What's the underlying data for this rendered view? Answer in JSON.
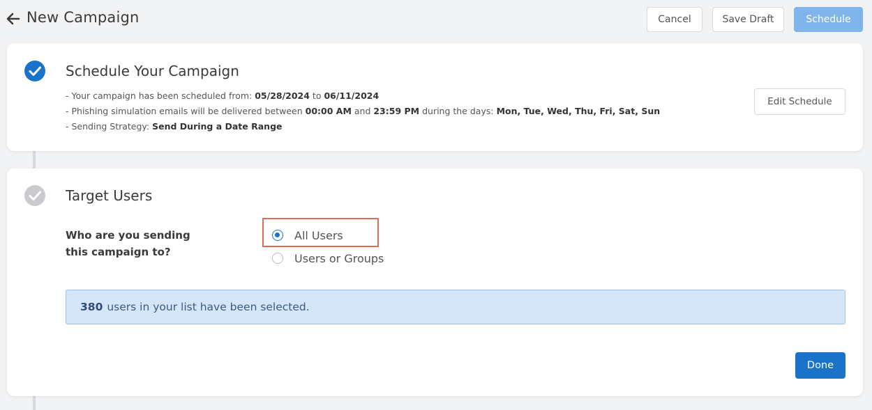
{
  "header": {
    "title": "New Campaign",
    "back_icon": "arrow-left-icon",
    "cancel_label": "Cancel",
    "save_draft_label": "Save Draft",
    "schedule_label": "Schedule"
  },
  "schedule_step": {
    "title": "Schedule Your Campaign",
    "status_icon": "check-circle-icon",
    "line1_prefix": "- Your campaign has been scheduled from: ",
    "start_date": "05/28/2024",
    "line1_to": " to ",
    "end_date": "06/11/2024",
    "line2_prefix": "- Phishing simulation emails will be delivered between ",
    "start_time": "00:00 AM",
    "line2_and": " and ",
    "end_time": "23:59 PM",
    "line2_days_prefix": " during the days: ",
    "days": "Mon, Tue, Wed, Thu, Fri, Sat, Sun",
    "line3_prefix": "- Sending Strategy: ",
    "strategy": "Send During a Date Range",
    "edit_label": "Edit Schedule"
  },
  "target_step": {
    "title": "Target Users",
    "status_icon": "check-circle-icon",
    "question_line1": "Who are you sending",
    "question_line2": "this campaign to?",
    "options": [
      {
        "label": "All Users",
        "selected": true
      },
      {
        "label": "Users or Groups",
        "selected": false
      }
    ],
    "selected_count": "380",
    "selected_text": "users in your list have been selected.",
    "done_label": "Done"
  },
  "colors": {
    "primary": "#1a73c8",
    "primary_disabled": "#7fb5ea",
    "highlight": "#e06b5a",
    "info_bg": "#d5e6f8"
  }
}
